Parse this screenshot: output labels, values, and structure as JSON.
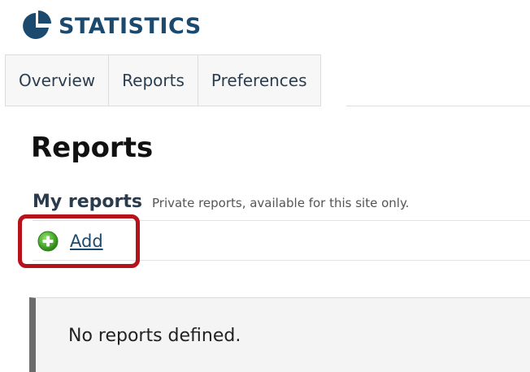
{
  "tool": {
    "title": "STATISTICS",
    "icon": "pie-chart-icon",
    "accent_color": "#1c4a6e"
  },
  "tabs": [
    {
      "label": "Overview"
    },
    {
      "label": "Reports"
    },
    {
      "label": "Preferences"
    }
  ],
  "page": {
    "heading": "Reports"
  },
  "my_reports": {
    "title": "My reports",
    "subtitle": "Private reports, available for this site only.",
    "add_label": "Add",
    "add_icon": "add-circle-icon",
    "empty_message": "No reports defined."
  },
  "annotation": {
    "highlight_color": "#b5121b"
  }
}
